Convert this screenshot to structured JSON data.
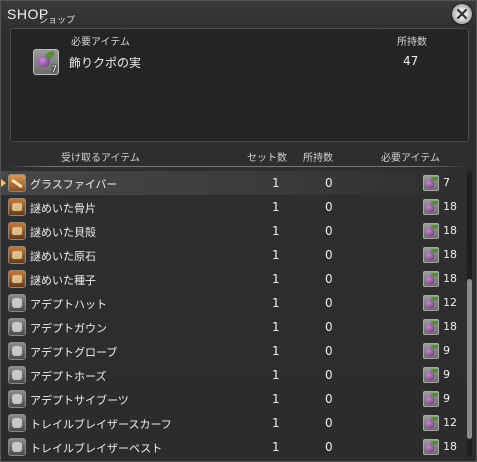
{
  "window": {
    "title": "SHOP",
    "subtitle": "ショップ"
  },
  "requirement": {
    "header_item": "必要アイテム",
    "header_owned": "所持数",
    "item_name": "飾りクポの実",
    "item_icon_qty": "7",
    "owned": "47"
  },
  "list": {
    "headers": {
      "receive": "受け取るアイテム",
      "sets": "セット数",
      "owned": "所持数",
      "required": "必要アイテム"
    },
    "rows": [
      {
        "name": "グラスファイバー",
        "sets": "1",
        "owned": "0",
        "cost": "7",
        "icon": "craft-material-icon"
      },
      {
        "name": "謎めいた骨片",
        "sets": "1",
        "owned": "0",
        "cost": "18",
        "icon": "treasure-box-icon"
      },
      {
        "name": "謎めいた貝殻",
        "sets": "1",
        "owned": "0",
        "cost": "18",
        "icon": "treasure-box-icon"
      },
      {
        "name": "謎めいた原石",
        "sets": "1",
        "owned": "0",
        "cost": "18",
        "icon": "treasure-box-icon"
      },
      {
        "name": "謎めいた種子",
        "sets": "1",
        "owned": "0",
        "cost": "18",
        "icon": "treasure-box-icon"
      },
      {
        "name": "アデプトハット",
        "sets": "1",
        "owned": "0",
        "cost": "12",
        "icon": "hat-icon"
      },
      {
        "name": "アデプトガウン",
        "sets": "1",
        "owned": "0",
        "cost": "18",
        "icon": "robe-icon"
      },
      {
        "name": "アデプトグローブ",
        "sets": "1",
        "owned": "0",
        "cost": "9",
        "icon": "gloves-icon"
      },
      {
        "name": "アデプトホーズ",
        "sets": "1",
        "owned": "0",
        "cost": "9",
        "icon": "pants-icon"
      },
      {
        "name": "アデプトサイブーツ",
        "sets": "1",
        "owned": "0",
        "cost": "9",
        "icon": "boots-icon"
      },
      {
        "name": "トレイルブレイザースカーフ",
        "sets": "1",
        "owned": "0",
        "cost": "12",
        "icon": "scarf-icon"
      },
      {
        "name": "トレイルブレイザーベスト",
        "sets": "1",
        "owned": "0",
        "cost": "18",
        "icon": "vest-icon"
      }
    ]
  },
  "colors": {
    "cursor": "#f3c46a",
    "text": "#efefef"
  }
}
